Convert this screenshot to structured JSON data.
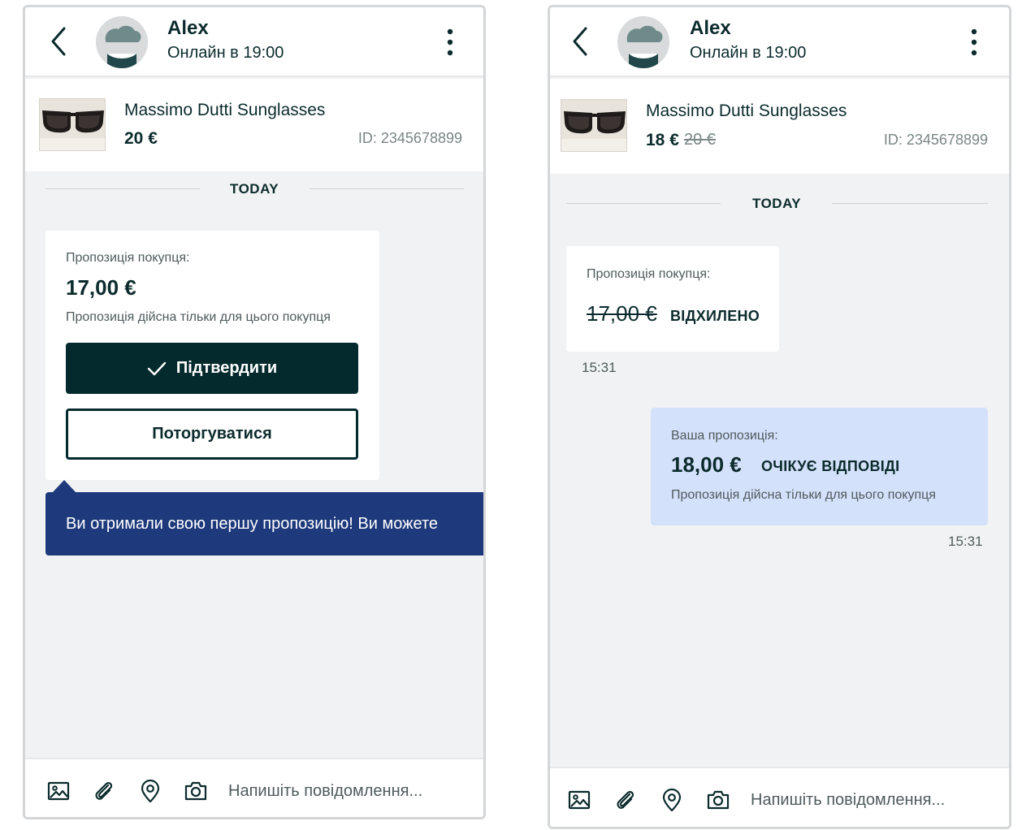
{
  "screens": [
    {
      "header": {
        "contact_name": "Alex",
        "status": "Онлайн в 19:00"
      },
      "product": {
        "title": "Massimo Dutti Sunglasses",
        "price": "20 €",
        "id": "ID: 2345678899"
      },
      "day_divider": "TODAY",
      "offer_card": {
        "label": "Пропозиція покупця:",
        "amount": "17,00 €",
        "note": "Пропозиція дійсна тільки для цього покупця",
        "confirm_label": "Підтвердити",
        "negotiate_label": "Поторгуватися"
      },
      "tooltip": "Ви отримали свою першу пропозицію! Ви можете",
      "composer": {
        "placeholder": "Напишіть повідомлення..."
      }
    },
    {
      "header": {
        "contact_name": "Alex",
        "status": "Онлайн в 19:00"
      },
      "product": {
        "title": "Massimo Dutti Sunglasses",
        "price": "18 €",
        "old_price": "20 €",
        "id": "ID: 2345678899"
      },
      "day_divider": "TODAY",
      "buyer_offer": {
        "label": "Пропозиція покупця:",
        "amount": "17,00 €",
        "status": "ВІДХИЛЕНО",
        "time": "15:31"
      },
      "your_offer": {
        "label": "Ваша пропозиція:",
        "amount": "18,00 €",
        "status": "ОЧІКУЄ ВІДПОВІДІ",
        "note": "Пропозиція дійсна тільки для цього покупця",
        "time": "15:31"
      },
      "composer": {
        "placeholder": "Напишіть повідомлення..."
      }
    }
  ],
  "icons": {
    "back": "chevron-left-icon",
    "more": "more-vertical-icon",
    "gallery": "image-icon",
    "attach": "paperclip-icon",
    "location": "location-pin-icon",
    "camera": "camera-icon",
    "check": "check-icon"
  },
  "colors": {
    "primary_dark": "#042a2d",
    "text_dark": "#0c2b2c",
    "tooltip_blue": "#1e3a7c",
    "own_bubble": "#d4e1fb",
    "chat_background": "#f1f2f3"
  }
}
